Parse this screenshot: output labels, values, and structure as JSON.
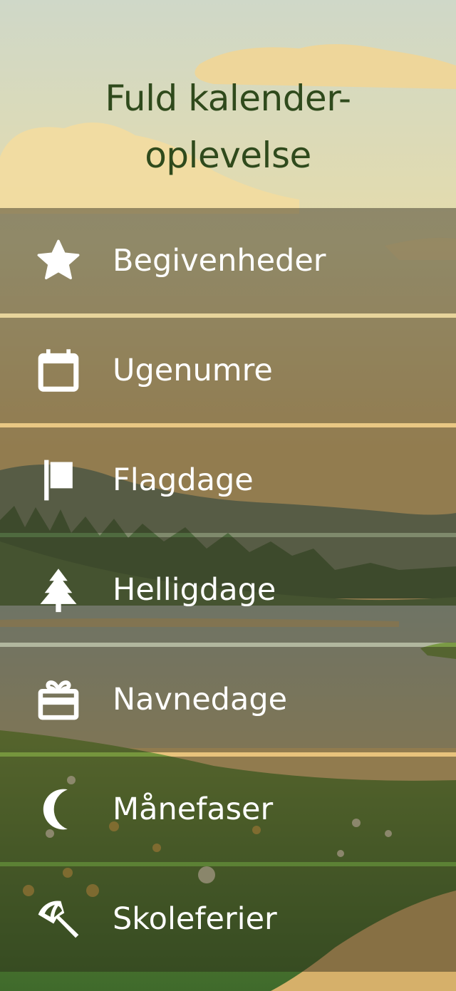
{
  "title_lines": [
    "Fuld kalender-",
    "oplevelse"
  ],
  "menu": [
    {
      "label": "Begivenheder",
      "icon": "star-icon"
    },
    {
      "label": "Ugenumre",
      "icon": "calendar-icon"
    },
    {
      "label": "Flagdage",
      "icon": "flag-icon"
    },
    {
      "label": "Helligdage",
      "icon": "tree-icon"
    },
    {
      "label": "Navnedage",
      "icon": "gift-icon"
    },
    {
      "label": "Månefaser",
      "icon": "moon-icon"
    },
    {
      "label": "Skoleferier",
      "icon": "umbrella-icon"
    }
  ],
  "colors": {
    "title": "#2f4a1c",
    "row_overlay": "#28241673",
    "separator": "#ecd296"
  }
}
